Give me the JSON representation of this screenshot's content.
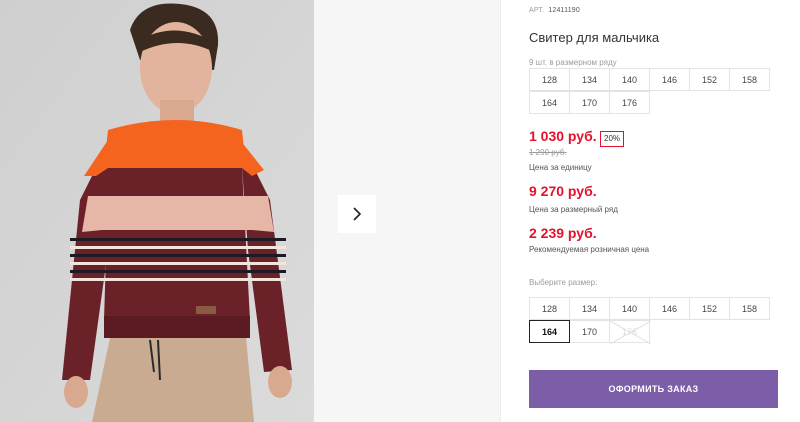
{
  "gallery": {
    "photo_alt": "Boy wearing a striped sweater",
    "next_icon": "chevron-right-icon"
  },
  "product": {
    "article_label": "АРТ.",
    "article_code": "12411190",
    "title": "Свитер для мальчика",
    "pack_note": "9 шт. в размерном ряду",
    "pack_sizes": [
      [
        "128",
        "134",
        "140",
        "146",
        "152",
        "158"
      ],
      [
        "164",
        "170",
        "176"
      ]
    ]
  },
  "prices": {
    "unit_price": "1 030 руб.",
    "discount": "20%",
    "old_price": "1 290 руб.",
    "unit_caption": "Цена за единицу",
    "series_price": "9 270 руб.",
    "series_caption": "Цена за размерный ряд",
    "retail_price": "2 239 руб.",
    "retail_caption": "Рекомендуемая розничная цена"
  },
  "size_picker": {
    "label": "Выберите размер:",
    "rows": [
      [
        "128",
        "134",
        "140",
        "146",
        "152",
        "158"
      ],
      [
        "164",
        "170",
        "176"
      ]
    ],
    "selected": "164",
    "disabled": "176"
  },
  "order": {
    "button_label": "ОФОРМИТЬ ЗАКАЗ"
  },
  "colors": {
    "accent_price": "#e3122b",
    "order_button": "#7b5ea7"
  }
}
